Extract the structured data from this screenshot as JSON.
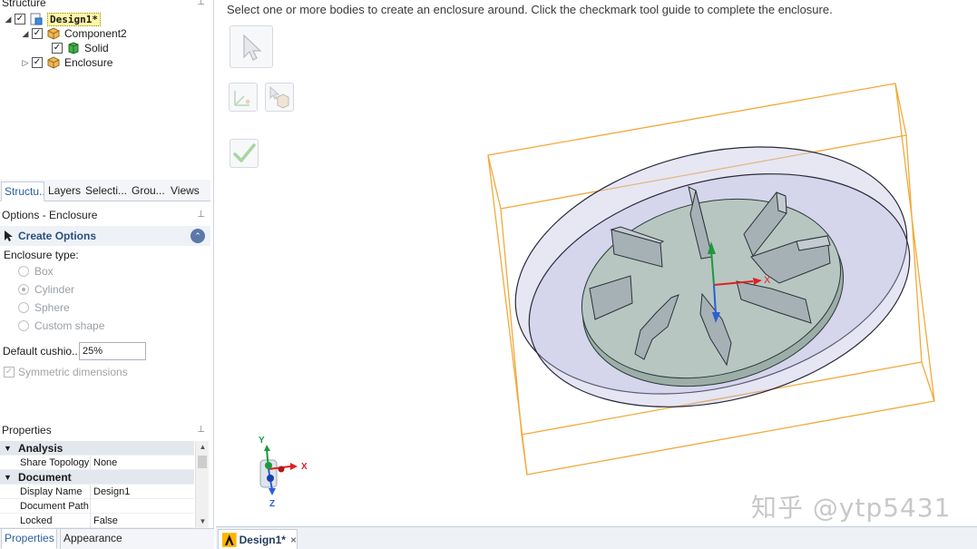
{
  "structure_panel": {
    "title": "Structure",
    "tree": [
      {
        "label": "Design1*",
        "level": 0,
        "expanded": true,
        "checked": true,
        "icon": "design-icon",
        "highlighted": true
      },
      {
        "label": "Component2",
        "level": 1,
        "expanded": true,
        "checked": true,
        "icon": "component-icon"
      },
      {
        "label": "Solid",
        "level": 2,
        "checked": true,
        "icon": "solid-icon"
      },
      {
        "label": "Enclosure",
        "level": 1,
        "expanded": false,
        "checked": true,
        "icon": "component-icon"
      }
    ]
  },
  "panel_tabs": [
    {
      "label": "Structu...",
      "active": true
    },
    {
      "label": "Layers"
    },
    {
      "label": "Selecti..."
    },
    {
      "label": "Grou..."
    },
    {
      "label": "Views"
    }
  ],
  "options": {
    "title": "Options - Enclosure",
    "section": "Create Options",
    "enclosure_type_label": "Enclosure type:",
    "types": [
      {
        "label": "Box",
        "selected": false
      },
      {
        "label": "Cylinder",
        "selected": true
      },
      {
        "label": "Sphere",
        "selected": false
      },
      {
        "label": "Custom shape",
        "selected": false
      }
    ],
    "cushion_label": "Default cushio...",
    "cushion_value": "25%",
    "symmetric_label": "Symmetric dimensions",
    "symmetric_checked": true
  },
  "properties": {
    "title": "Properties",
    "rows": [
      {
        "type": "category",
        "label": "Analysis"
      },
      {
        "type": "prop",
        "key": "Share Topology",
        "value": "None"
      },
      {
        "type": "category",
        "label": "Document"
      },
      {
        "type": "prop",
        "key": "Display Name",
        "value": "Design1"
      },
      {
        "type": "prop",
        "key": "Document Path",
        "value": ""
      },
      {
        "type": "prop",
        "key": "Locked",
        "value": "False"
      }
    ]
  },
  "bottom_tabs": [
    {
      "label": "Properties",
      "active": true
    },
    {
      "label": "Appearance"
    }
  ],
  "canvas": {
    "prompt": "Select one or more bodies to create an enclosure around. Click the checkmark tool guide to complete the enclosure.",
    "axis_labels": {
      "x": "X",
      "y": "Y",
      "z": "Z"
    },
    "watermark": "知乎 @ytp5431"
  },
  "document_tab": {
    "label": "Design1*",
    "close": "×"
  },
  "colors": {
    "bbox": "#f2a93b",
    "enclosure": "#c9c9e6",
    "solid": "#b8c6c2",
    "x_axis": "#e02020",
    "y_axis": "#1c9a3c",
    "z_axis": "#2a5fd6",
    "accent": "#2a5f9e"
  }
}
